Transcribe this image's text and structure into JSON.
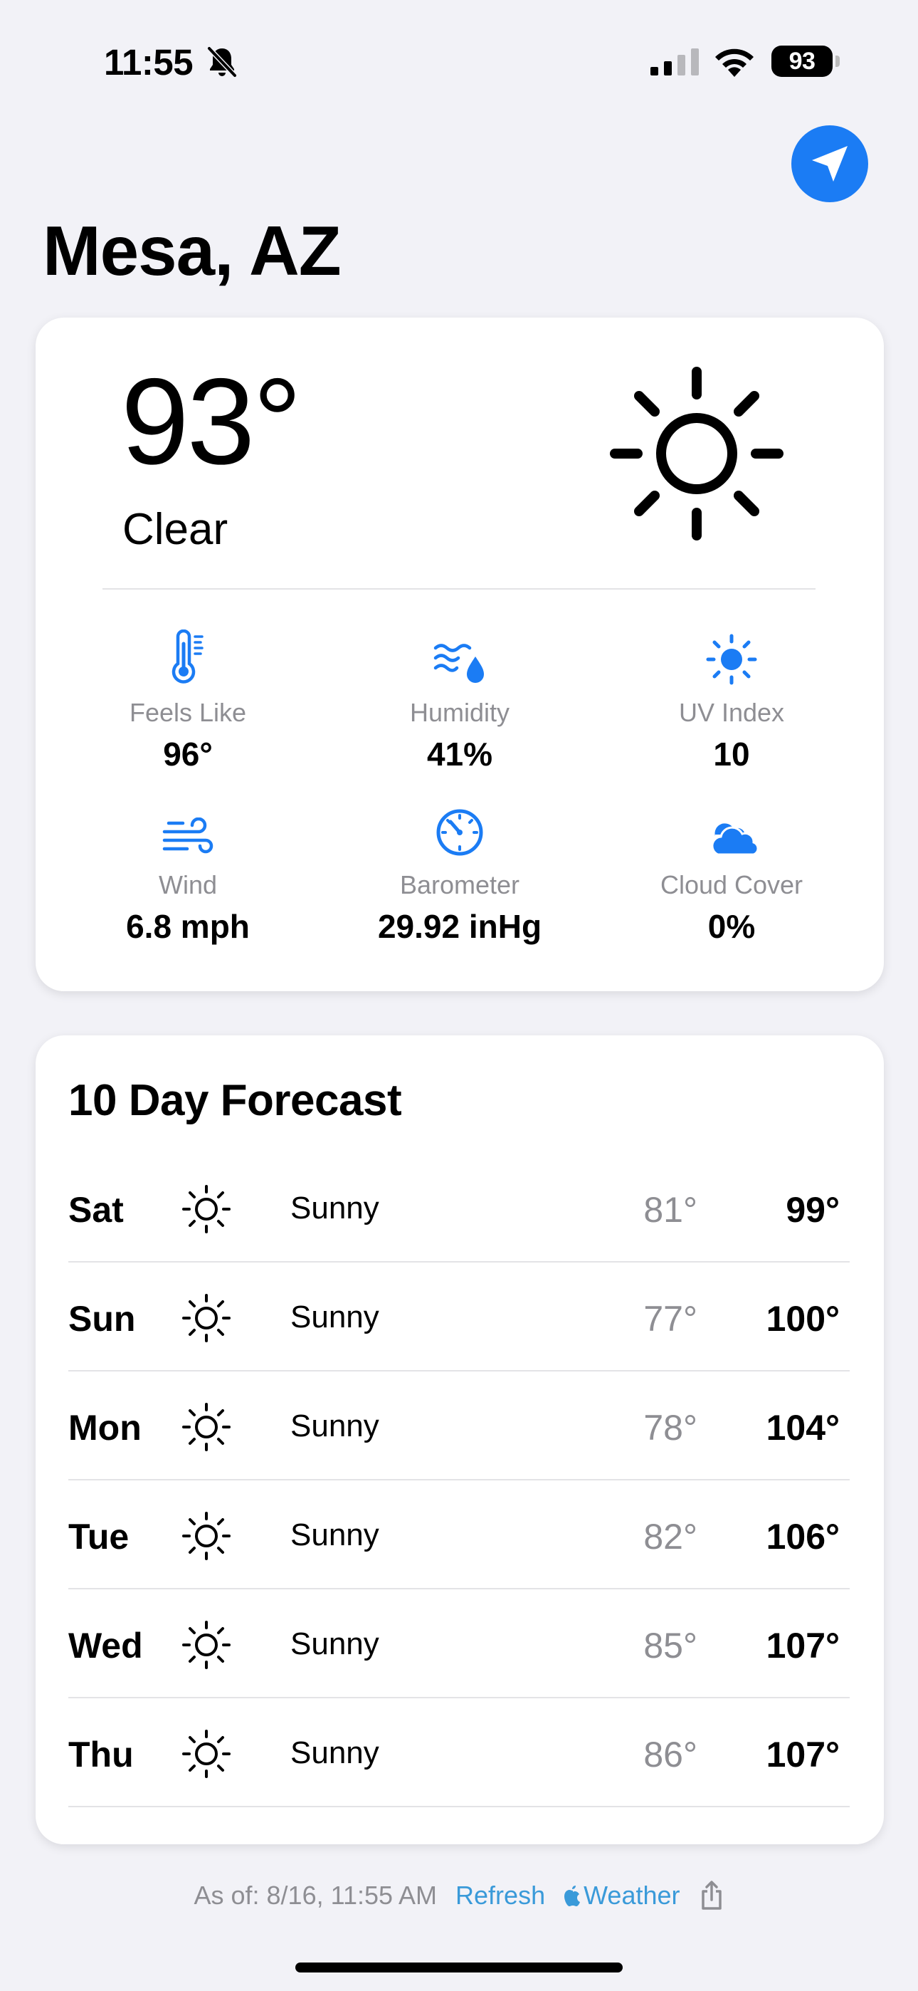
{
  "status_bar": {
    "time": "11:55",
    "battery": "93",
    "icons": [
      "bell-slash-icon",
      "cellular-signal-icon",
      "wifi-icon",
      "battery-icon"
    ]
  },
  "header": {
    "city": "Mesa, AZ",
    "location_icon": "location-arrow-icon",
    "accent_color": "#1b7cf4"
  },
  "current": {
    "temperature": "93°",
    "condition": "Clear",
    "icon": "sun-icon",
    "metrics": [
      {
        "id": "feels-like",
        "label": "Feels Like",
        "value": "96°",
        "icon": "thermometer-icon"
      },
      {
        "id": "humidity",
        "label": "Humidity",
        "value": "41%",
        "icon": "humidity-icon"
      },
      {
        "id": "uv-index",
        "label": "UV Index",
        "value": "10",
        "icon": "sun-max-icon"
      },
      {
        "id": "wind",
        "label": "Wind",
        "value": "6.8 mph",
        "icon": "wind-icon"
      },
      {
        "id": "barometer",
        "label": "Barometer",
        "value": "29.92 inHg",
        "icon": "gauge-icon"
      },
      {
        "id": "cloud-cover",
        "label": "Cloud Cover",
        "value": "0%",
        "icon": "cloud-icon"
      }
    ]
  },
  "forecast": {
    "title": "10 Day Forecast",
    "days": [
      {
        "day": "Sat",
        "condition": "Sunny",
        "low": "81°",
        "high": "99°",
        "icon": "sun-icon"
      },
      {
        "day": "Sun",
        "condition": "Sunny",
        "low": "77°",
        "high": "100°",
        "icon": "sun-icon"
      },
      {
        "day": "Mon",
        "condition": "Sunny",
        "low": "78°",
        "high": "104°",
        "icon": "sun-icon"
      },
      {
        "day": "Tue",
        "condition": "Sunny",
        "low": "82°",
        "high": "106°",
        "icon": "sun-icon"
      },
      {
        "day": "Wed",
        "condition": "Sunny",
        "low": "85°",
        "high": "107°",
        "icon": "sun-icon"
      },
      {
        "day": "Thu",
        "condition": "Sunny",
        "low": "86°",
        "high": "107°",
        "icon": "sun-icon"
      }
    ]
  },
  "footer": {
    "as_of": "As of: 8/16, 11:55 AM",
    "refresh": "Refresh",
    "weather": "Weather",
    "link_color": "#3a9ad9"
  }
}
